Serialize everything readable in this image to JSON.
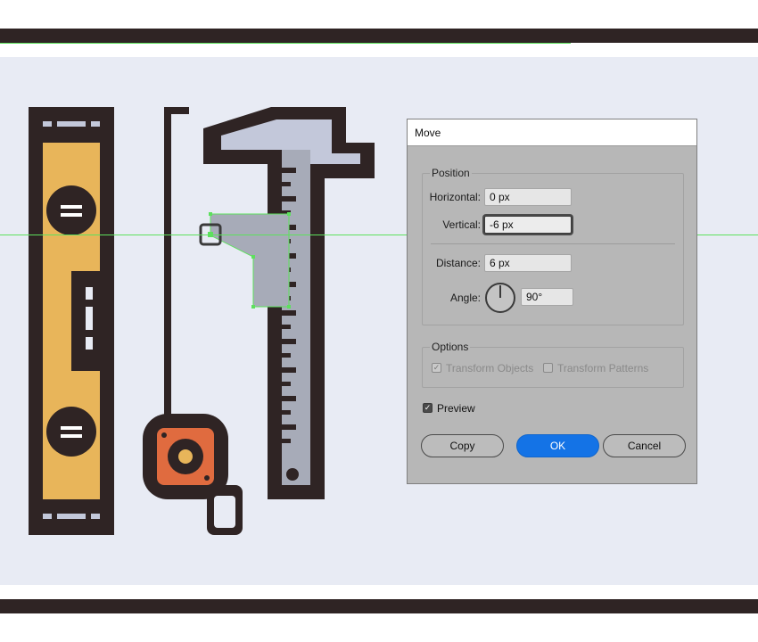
{
  "colors": {
    "dark": "#2f2424",
    "canvas": "#e8ebf4",
    "level_yellow": "#e8b55a",
    "tape_orange": "#e06b3f",
    "caliper_light": "#c3c8da",
    "caliper_mid": "#a7abb8",
    "guide_green": "#5de05d",
    "accent_blue": "#1473e6"
  },
  "dialog": {
    "title": "Move",
    "position": {
      "legend": "Position",
      "horizontal_label": "Horizontal:",
      "horizontal_value": "0 px",
      "vertical_label": "Vertical:",
      "vertical_value": "-6 px",
      "distance_label": "Distance:",
      "distance_value": "6 px",
      "angle_label": "Angle:",
      "angle_value": "90°",
      "angle_icon": "angle-dial-icon"
    },
    "options": {
      "legend": "Options",
      "transform_objects_label": "Transform Objects",
      "transform_objects_checked": true,
      "transform_patterns_label": "Transform Patterns",
      "transform_patterns_checked": false
    },
    "preview_label": "Preview",
    "preview_checked": true,
    "buttons": {
      "copy": "Copy",
      "ok": "OK",
      "cancel": "Cancel"
    }
  }
}
